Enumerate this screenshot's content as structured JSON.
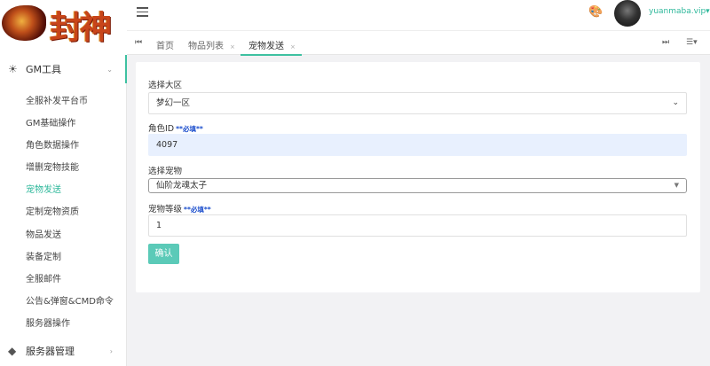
{
  "brand": {
    "logo_text": "封神"
  },
  "sidebar": {
    "groups": [
      {
        "label": "GM工具"
      },
      {
        "label": "服务器管理"
      }
    ],
    "items": [
      {
        "label": "全服补发平台币"
      },
      {
        "label": "GM基础操作"
      },
      {
        "label": "角色数据操作"
      },
      {
        "label": "增删宠物技能"
      },
      {
        "label": "宠物发送"
      },
      {
        "label": "定制宠物资质"
      },
      {
        "label": "物品发送"
      },
      {
        "label": "装备定制"
      },
      {
        "label": "全服邮件"
      },
      {
        "label": "公告&弹窗&CMD命令"
      },
      {
        "label": "服务器操作"
      }
    ],
    "active_item": "宠物发送",
    "accent": "#3ec1a1"
  },
  "topbar": {
    "username": "yuanmaba.vip",
    "username_caret": "▾"
  },
  "tabs": {
    "items": [
      {
        "label": "首页"
      },
      {
        "label": "物品列表"
      },
      {
        "label": "宠物发送"
      }
    ],
    "active": "宠物发送"
  },
  "form": {
    "server_label": "选择大区",
    "server_value": "梦幻一区",
    "role_label": "角色ID",
    "role_required": "**必填**",
    "role_value": "4097",
    "pet_label": "选择宠物",
    "pet_value": "仙阶龙魂太子",
    "level_label": "宠物等级",
    "level_required": "**必填**",
    "level_value": "1",
    "confirm_label": "确认"
  }
}
